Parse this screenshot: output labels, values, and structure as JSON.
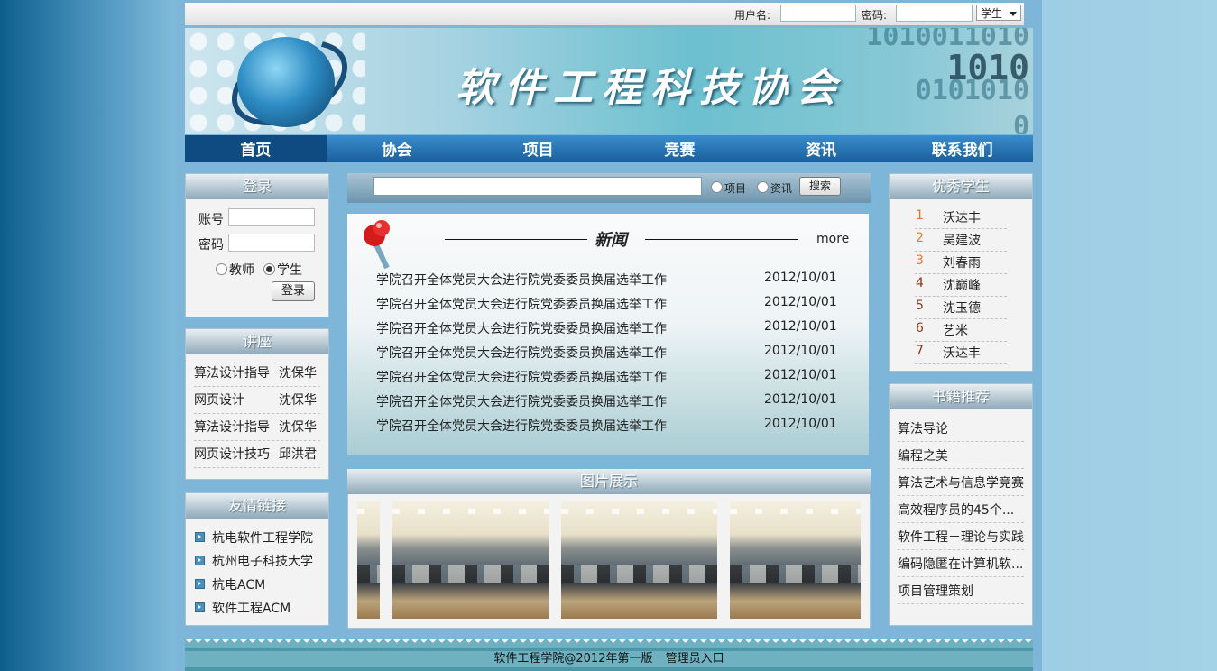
{
  "topbar": {
    "user_label": "用户名:",
    "pwd_label": "密码:",
    "role_select": "学生"
  },
  "banner": {
    "title": "软件工程科技协会",
    "binary": [
      "1010011010",
      "1010",
      "0101010",
      "0"
    ]
  },
  "nav": [
    {
      "label": "首页",
      "active": true
    },
    {
      "label": "协会"
    },
    {
      "label": "项目"
    },
    {
      "label": "竞赛"
    },
    {
      "label": "资讯"
    },
    {
      "label": "联系我们"
    }
  ],
  "login": {
    "title": "登录",
    "account_label": "账号",
    "password_label": "密码",
    "role_teacher": "教师",
    "role_student": "学生",
    "selected_role": "学生",
    "submit": "登录"
  },
  "lectures": {
    "title": "讲座",
    "items": [
      {
        "topic": "算法设计指导",
        "speaker": "沈保华"
      },
      {
        "topic": "网页设计",
        "speaker": "沈保华"
      },
      {
        "topic": "算法设计指导",
        "speaker": "沈保华"
      },
      {
        "topic": "网页设计技巧",
        "speaker": "邱洪君"
      }
    ]
  },
  "links": {
    "title": "友情链接",
    "items": [
      "杭电软件工程学院",
      "杭州电子科技大学",
      "杭电ACM",
      "软件工程ACM"
    ]
  },
  "search": {
    "opt_project": "项目",
    "opt_news": "资讯",
    "button": "搜索"
  },
  "news": {
    "title": "新闻",
    "more": "more",
    "items": [
      {
        "title": "学院召开全体党员大会进行院党委委员换届选举工作",
        "date": "2012/10/01"
      },
      {
        "title": "学院召开全体党员大会进行院党委委员换届选举工作",
        "date": "2012/10/01"
      },
      {
        "title": "学院召开全体党员大会进行院党委委员换届选举工作",
        "date": "2012/10/01"
      },
      {
        "title": "学院召开全体党员大会进行院党委委员换届选举工作",
        "date": "2012/10/01"
      },
      {
        "title": "学院召开全体党员大会进行院党委委员换届选举工作",
        "date": "2012/10/01"
      },
      {
        "title": "学院召开全体党员大会进行院党委委员换届选举工作",
        "date": "2012/10/01"
      },
      {
        "title": "学院召开全体党员大会进行院党委委员换届选举工作",
        "date": "2012/10/01"
      }
    ]
  },
  "gallery": {
    "title": "图片展示",
    "count": 4
  },
  "students": {
    "title": "优秀学生",
    "items": [
      {
        "rank": "1",
        "name": "沃达丰"
      },
      {
        "rank": "2",
        "name": "吴建波"
      },
      {
        "rank": "3",
        "name": "刘春雨"
      },
      {
        "rank": "4",
        "name": "沈巅峰"
      },
      {
        "rank": "5",
        "name": "沈玉德"
      },
      {
        "rank": "6",
        "name": "艺米"
      },
      {
        "rank": "7",
        "name": "沃达丰"
      }
    ]
  },
  "books": {
    "title": "书籍推荐",
    "items": [
      "算法导论",
      "编程之美",
      "算法艺术与信息学竞赛",
      "高效程序员的45个...",
      "软件工程－理论与实践",
      "编码隐匿在计算机软...",
      "项目管理策划"
    ]
  },
  "footer": {
    "copyright": "软件工程学院@2012年第一版",
    "admin": "管理员入口"
  },
  "colors": {
    "nav_active": "#0f4a80",
    "rank_orange": "#e07a2e",
    "rank_brown": "#8a3a1a"
  }
}
